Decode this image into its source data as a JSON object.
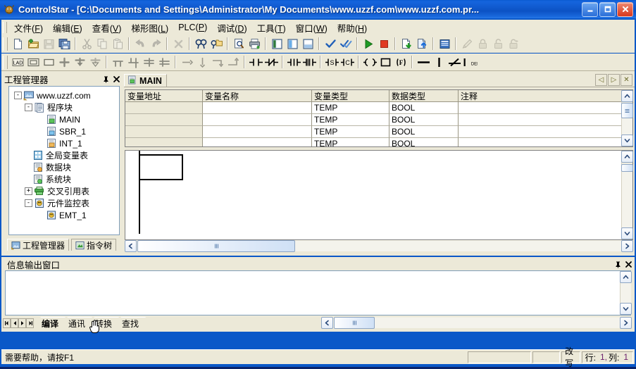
{
  "window": {
    "title": "ControlStar - [C:\\Documents and Settings\\Administrator\\My Documents\\www.uzzf.com\\www.uzzf.com.pr...",
    "app_icon": "application-icon",
    "minimize_label": "_",
    "maximize_label": "□",
    "close_label": "✕"
  },
  "menubar": {
    "items": [
      {
        "text": "文件",
        "accel": "F"
      },
      {
        "text": "编辑",
        "accel": "E"
      },
      {
        "text": "查看",
        "accel": "V"
      },
      {
        "text": "梯形图",
        "accel": "L"
      },
      {
        "text": "PLC",
        "accel": "P"
      },
      {
        "text": "调试",
        "accel": "D"
      },
      {
        "text": "工具",
        "accel": "T"
      },
      {
        "text": "窗口",
        "accel": "W"
      },
      {
        "text": "帮助",
        "accel": "H"
      }
    ]
  },
  "toolbar_standard": {
    "buttons": [
      {
        "name": "new-file-icon",
        "enabled": true
      },
      {
        "name": "open-folder-icon",
        "enabled": true
      },
      {
        "name": "save-icon",
        "enabled": false
      },
      {
        "name": "save-all-icon",
        "enabled": true
      },
      {
        "name": "cut-icon",
        "enabled": false
      },
      {
        "name": "copy-icon",
        "enabled": false
      },
      {
        "name": "paste-icon",
        "enabled": false
      },
      {
        "name": "undo-icon",
        "enabled": false
      },
      {
        "name": "redo-icon",
        "enabled": false
      },
      {
        "name": "delete-icon",
        "enabled": false
      },
      {
        "name": "find-icon",
        "enabled": true
      },
      {
        "name": "find-replace-icon",
        "enabled": true
      },
      {
        "name": "print-preview-icon",
        "enabled": true
      },
      {
        "name": "print-icon",
        "enabled": true
      },
      {
        "name": "project-manager-icon",
        "enabled": true
      },
      {
        "name": "instruction-tree-icon",
        "enabled": true
      },
      {
        "name": "output-window-icon",
        "enabled": true
      },
      {
        "name": "compile-icon",
        "enabled": true
      },
      {
        "name": "compile-all-icon",
        "enabled": true
      },
      {
        "name": "run-icon",
        "enabled": true
      },
      {
        "name": "stop-icon",
        "enabled": true
      },
      {
        "name": "download-icon",
        "enabled": true
      },
      {
        "name": "upload-icon",
        "enabled": true
      },
      {
        "name": "monitor-icon",
        "enabled": true
      },
      {
        "name": "edit-pencil-icon",
        "enabled": false
      },
      {
        "name": "lock-closed-icon",
        "enabled": false
      },
      {
        "name": "lock-open-icon",
        "enabled": false
      },
      {
        "name": "lock-key-icon",
        "enabled": false
      }
    ]
  },
  "toolbar_ladder": {
    "buttons": [
      {
        "name": "label-icon",
        "label": "LAD"
      },
      {
        "name": "network-box-icon",
        "label": ""
      },
      {
        "name": "box-icon",
        "label": ""
      },
      {
        "name": "insert-row-icon",
        "label": ""
      },
      {
        "name": "insert-down-icon",
        "label": ""
      },
      {
        "name": "delete-down-icon",
        "label": ""
      },
      {
        "name": "insert-branch-down-left-icon",
        "label": ""
      },
      {
        "name": "insert-branch-up-icon",
        "label": ""
      },
      {
        "name": "insert-branch-right-icon",
        "label": ""
      },
      {
        "name": "insert-branch-down-icon",
        "label": ""
      },
      {
        "name": "arrow-right-icon",
        "label": ""
      },
      {
        "name": "arrow-down-icon",
        "label": ""
      },
      {
        "name": "arrow-turn-down-icon",
        "label": ""
      },
      {
        "name": "arrow-turn-up-icon",
        "label": ""
      },
      {
        "name": "contact-no-icon",
        "label": ""
      },
      {
        "name": "contact-nc-icon",
        "label": ""
      },
      {
        "name": "contact-positive-edge-icon",
        "label": ""
      },
      {
        "name": "contact-negative-edge-icon",
        "label": ""
      },
      {
        "name": "coil-set-icon",
        "label": "S"
      },
      {
        "name": "coil-reset-icon",
        "label": "C"
      },
      {
        "name": "coil-icon",
        "label": ""
      },
      {
        "name": "function-box-icon",
        "label": ""
      },
      {
        "name": "function-f-icon",
        "label": "F"
      },
      {
        "name": "horizontal-line-icon",
        "label": ""
      },
      {
        "name": "vertical-line-icon",
        "label": ""
      },
      {
        "name": "delete-line-icon",
        "label": ""
      },
      {
        "name": "delete-vertical-icon",
        "label": "DEL"
      }
    ]
  },
  "project_panel": {
    "title": "工程管理器",
    "pin_icon": "pin-icon",
    "close_icon": "close-icon",
    "tree": [
      {
        "label": "www.uzzf.com",
        "level": 0,
        "expander": "-",
        "icon": "project-root-icon"
      },
      {
        "label": "程序块",
        "level": 1,
        "expander": "-",
        "icon": "program-block-icon"
      },
      {
        "label": "MAIN",
        "level": 2,
        "expander": "",
        "icon": "pou-green-icon"
      },
      {
        "label": "SBR_1",
        "level": 2,
        "expander": "",
        "icon": "pou-blue-icon"
      },
      {
        "label": "INT_1",
        "level": 2,
        "expander": "",
        "icon": "pou-orange-icon"
      },
      {
        "label": "全局变量表",
        "level": 1,
        "expander": "",
        "icon": "global-var-table-icon"
      },
      {
        "label": "数据块",
        "level": 1,
        "expander": "",
        "icon": "data-block-icon"
      },
      {
        "label": "系统块",
        "level": 1,
        "expander": "",
        "icon": "system-block-icon"
      },
      {
        "label": "交叉引用表",
        "level": 1,
        "expander": "+",
        "icon": "cross-reference-icon"
      },
      {
        "label": "元件监控表",
        "level": 1,
        "expander": "-",
        "icon": "monitor-table-icon"
      },
      {
        "label": "EMT_1",
        "level": 2,
        "expander": "",
        "icon": "monitor-entry-icon"
      }
    ],
    "tabs": [
      {
        "label": "工程管理器",
        "icon": "project-manager-icon",
        "active": true
      },
      {
        "label": "指令树",
        "icon": "instruction-tree-icon",
        "active": false
      }
    ]
  },
  "document_area": {
    "tabs": [
      {
        "label": "MAIN",
        "icon": "pou-green-icon",
        "active": true
      }
    ],
    "tab_nav": {
      "prev_label": "◁",
      "next_label": "▷",
      "close_label": "✕"
    },
    "variable_table": {
      "columns": [
        "变量地址",
        "变量名称",
        "变量类型",
        "数据类型",
        "注释"
      ],
      "rows": [
        {
          "addr": "",
          "name": "",
          "vartype": "TEMP",
          "datatype": "BOOL",
          "comment": "",
          "selected": true
        },
        {
          "addr": "",
          "name": "",
          "vartype": "TEMP",
          "datatype": "BOOL",
          "comment": "",
          "selected": false
        },
        {
          "addr": "",
          "name": "",
          "vartype": "TEMP",
          "datatype": "BOOL",
          "comment": "",
          "selected": false
        },
        {
          "addr": "",
          "name": "",
          "vartype": "TEMP",
          "datatype": "BOOL",
          "comment": "",
          "selected": false
        }
      ]
    },
    "ladder_editor": {
      "cursor_cell": "selected-network-cell",
      "content": ""
    }
  },
  "output_window": {
    "title": "信息输出窗口",
    "pin_icon": "pin-icon",
    "close_icon": "close-icon",
    "content": "",
    "nav_buttons": [
      "◀▐",
      "◀",
      "▶",
      "▐▶"
    ],
    "tabs": [
      {
        "label": "编译",
        "active": true
      },
      {
        "label": "通讯",
        "active": false
      },
      {
        "label": "转换",
        "active": false
      },
      {
        "label": "查找",
        "active": false
      }
    ]
  },
  "statusbar": {
    "message": "需要帮助，请按F1",
    "pane1": "",
    "pane2": "",
    "overwrite": "改写",
    "row_label": "行:",
    "row_value": "1,",
    "col_label": "列:",
    "col_value": "1"
  },
  "colors": {
    "titlebar_blue": "#0f58cc",
    "face": "#ece9d8",
    "selection_blue": "#2f6fce",
    "close_red": "#d8371d",
    "status_number": "#6b1f6b"
  }
}
